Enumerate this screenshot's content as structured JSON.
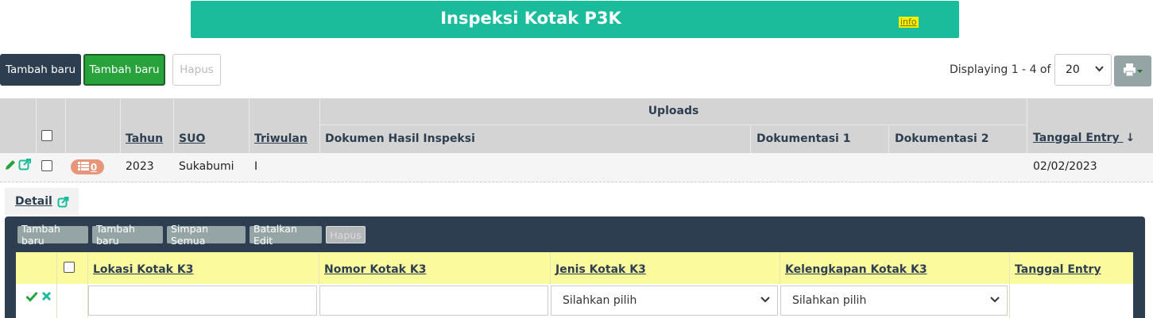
{
  "banner": {
    "title": "Inspeksi Kotak P3K",
    "info": "info"
  },
  "toolbar": {
    "add_label_1": "Tambah baru",
    "add_label_2": "Tambah baru",
    "delete_label": "Hapus",
    "displaying": "Displaying 1 - 4 of 4",
    "page_size": "20"
  },
  "grid": {
    "group_header": "Uploads",
    "columns": [
      "Tahun",
      "SUO",
      "Triwulan",
      "Dokumen Hasil Inspeksi",
      "Dokumentasi 1",
      "Dokumentasi 2",
      "Tanggal Entry"
    ],
    "sort_indicator": "↓",
    "rows": [
      {
        "badge_count": "0",
        "tahun": "2023",
        "suo": "Sukabumi",
        "triwulan": "I",
        "tanggal_entry": "02/02/2023"
      }
    ]
  },
  "detail": {
    "tab_label": "Detail",
    "toolbar": [
      "Tambah baru",
      "Tambah baru",
      "Simpan Semua",
      "Batalkan Edit",
      "Hapus"
    ],
    "columns": [
      "Lokasi Kotak K3",
      "Nomor Kotak K3",
      "Jenis Kotak K3",
      "Kelengkapan Kotak K3",
      "Tanggal Entry"
    ],
    "select_placeholder_1": "Silahkan pilih",
    "select_placeholder_2": "Silahkan pilih"
  },
  "colors": {
    "banner": "#1abc9c",
    "dark": "#2c3e50",
    "green": "#28a23a",
    "badge": "#e8967a",
    "subhead": "#fbfb9e"
  },
  "icons": [
    "pencil-icon",
    "edit-external-icon",
    "list-icon",
    "external-link-icon",
    "print-icon",
    "check-icon",
    "cancel-icon",
    "chevron-down-icon"
  ]
}
